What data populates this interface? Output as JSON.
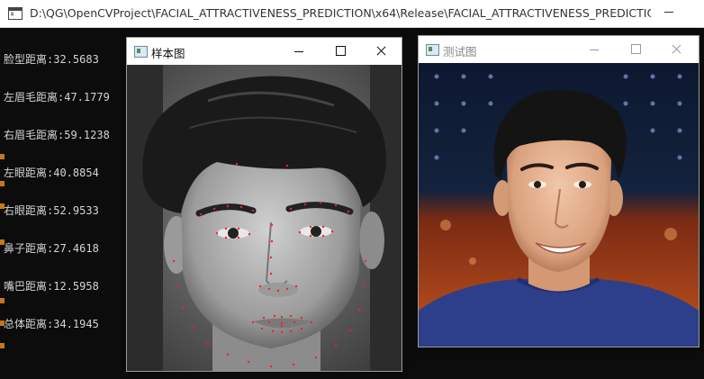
{
  "console": {
    "title": "D:\\QG\\OpenCVProject\\FACIAL_ATTRACTIVENESS_PREDICTION\\x64\\Release\\FACIAL_ATTRACTIVENESS_PREDICTION.e...",
    "lines": [
      "脸型距离:32.5683",
      "左眉毛距离:47.1779",
      "右眉毛距离:59.1238",
      "左眼距离:40.8854",
      "右眼距离:52.9533",
      "鼻子距离:27.4618",
      "嘴巴距离:12.5958",
      "总体距离:34.1945"
    ]
  },
  "sample_window": {
    "title": "样本图"
  },
  "test_window": {
    "title": "测试图"
  },
  "colors": {
    "landmark": "#ff2020",
    "console_text": "#d4d4d4",
    "console_bg": "#0c0c0c"
  }
}
